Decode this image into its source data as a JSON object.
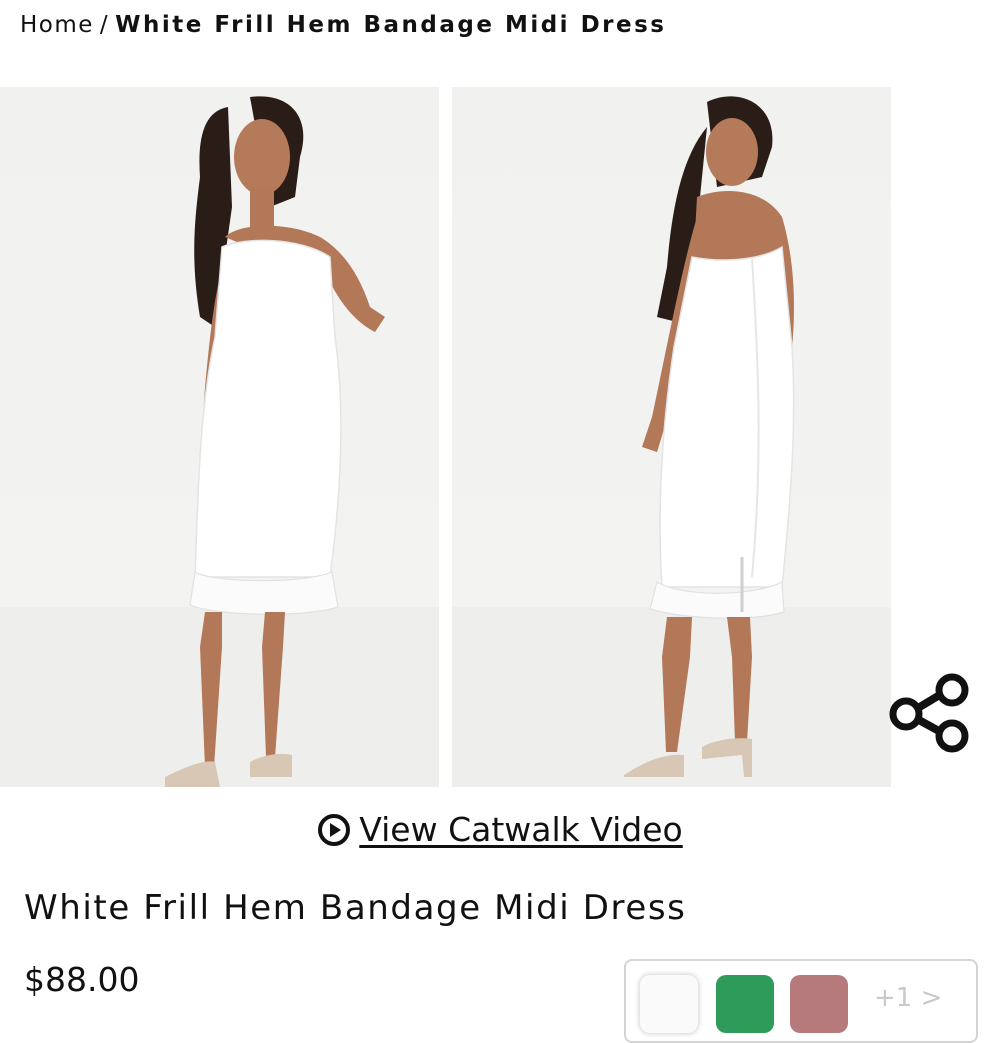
{
  "breadcrumb": {
    "home": "Home",
    "separator": "/",
    "current": "White Frill Hem Bandage Midi Dress"
  },
  "gallery": {
    "images": [
      {
        "label": "front view",
        "icon": "model-front-photo"
      },
      {
        "label": "back view",
        "icon": "model-back-photo"
      }
    ],
    "share_icon": "share-icon"
  },
  "catwalk": {
    "icon": "play-circle-icon",
    "label": "View Catwalk Video"
  },
  "product": {
    "title": "White Frill Hem Bandage Midi Dress",
    "price": "$88.00"
  },
  "swatches": {
    "colors": [
      "#fafafa",
      "#2f9b5a",
      "#b77a7c"
    ],
    "more_label": "+1 >"
  }
}
